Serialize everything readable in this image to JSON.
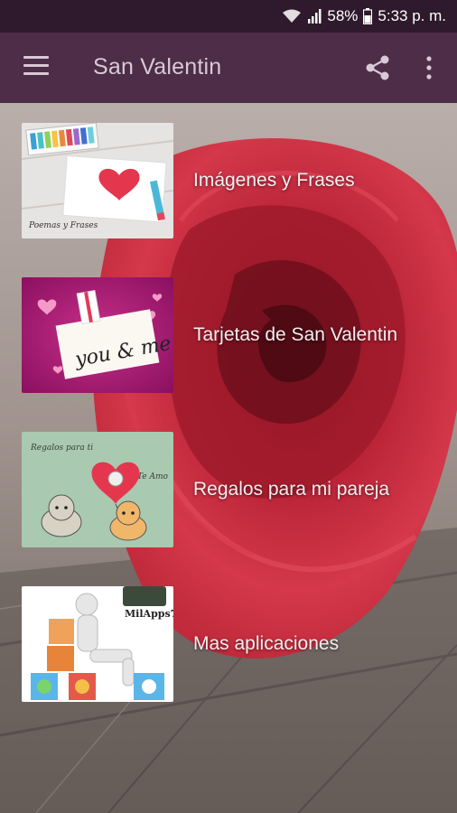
{
  "status": {
    "battery": "58%",
    "time": "5:33 p. m."
  },
  "app_bar": {
    "title": "San Valentin",
    "menu_icon": "hamburger-menu-icon",
    "share_icon": "share-icon",
    "more_icon": "more-vert-icon"
  },
  "items": [
    {
      "label": "Imágenes y Frases",
      "thumb_caption": "Poemas y Frases"
    },
    {
      "label": "Tarjetas de San Valentin",
      "thumb_caption": "you & me"
    },
    {
      "label": "Regalos para mi pareja",
      "thumb_caption": "Regalos para ti",
      "thumb_caption_b": "Te Amo"
    },
    {
      "label": "Mas aplicaciones",
      "thumb_caption": "MilApps7"
    }
  ],
  "colors": {
    "status_bar": "#2e1a2c",
    "app_bar": "#4d2d47",
    "app_bar_text": "#d9c9d6",
    "rose": "#c0263a"
  }
}
